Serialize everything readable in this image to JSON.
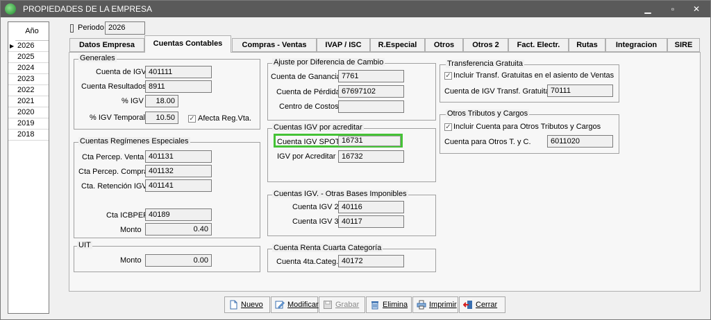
{
  "window": {
    "title": "PROPIEDADES DE LA EMPRESA",
    "min": "▁",
    "max": "▫",
    "close": "✕"
  },
  "years": {
    "header": "Año",
    "rows": [
      "2026",
      "2025",
      "2024",
      "2023",
      "2022",
      "2021",
      "2020",
      "2019",
      "2018"
    ],
    "selected_marker": "▶"
  },
  "periodo": {
    "label": "Periodo",
    "value": "2026"
  },
  "tabs": [
    "Datos Empresa",
    "Cuentas Contables",
    "Compras - Ventas",
    "IVAP / ISC",
    "R.Especial",
    "Otros",
    "Otros 2",
    "Fact. Electr.",
    "Rutas",
    "Integracion",
    "SIRE"
  ],
  "generales": {
    "title": "Generales",
    "cuenta_igv": {
      "label": "Cuenta de IGV",
      "value": "401111"
    },
    "cuenta_resultados": {
      "label": "Cuenta Resultados",
      "value": "8911"
    },
    "pct_igv": {
      "label": "% IGV",
      "value": "18.00"
    },
    "pct_igv_temporal": {
      "label": "% IGV Temporal",
      "value": "10.50"
    },
    "afecta": {
      "label": "Afecta Reg.Vta.",
      "mark": "✓"
    }
  },
  "regimenes": {
    "title": "Cuentas Regímenes Especiales",
    "percep_venta": {
      "label": "Cta Percep. Venta",
      "value": "401131"
    },
    "percep_compra": {
      "label": "Cta Percep. Compra",
      "value": "401132"
    },
    "retencion": {
      "label": "Cta. Retención IGV",
      "value": "401141"
    },
    "icbper": {
      "label": "Cta ICBPER",
      "value": "40189"
    },
    "monto": {
      "label": "Monto",
      "value": "0.40"
    }
  },
  "uit": {
    "title": "UIT",
    "monto": {
      "label": "Monto",
      "value": "0.00"
    }
  },
  "ajuste": {
    "title": "Ajuste por Diferencia de Cambio",
    "ganancia": {
      "label": "Cuenta de Ganancia",
      "value": "7761"
    },
    "perdida": {
      "label": "Cuenta de Pérdida",
      "value": "67697102"
    },
    "centro": {
      "label": "Centro de Costos",
      "value": ""
    }
  },
  "igv_acreditar": {
    "title": "Cuentas IGV por acreditar",
    "spot": {
      "label": "Cuenta IGV SPOT",
      "value": "16731"
    },
    "acreditar": {
      "label": "IGV por Acreditar",
      "value": "16732"
    }
  },
  "otras_bases": {
    "title": "Cuentas IGV. - Otras Bases Imponibles",
    "igv2": {
      "label": "Cuenta IGV 2",
      "value": "40116"
    },
    "igv3": {
      "label": "Cuenta IGV 3",
      "value": "40117"
    }
  },
  "renta_cuarta": {
    "title": "Cuenta Renta Cuarta Categoría",
    "cuenta": {
      "label": "Cuenta 4ta.Categ.:",
      "value": "40172"
    }
  },
  "transferencia": {
    "title": "Transferencia Gratuita",
    "check": {
      "label": "Incluir Transf. Gratuitas en el asiento de Ventas",
      "mark": "✓"
    },
    "cuenta": {
      "label": "Cuenta de IGV Transf. Gratuita",
      "value": "70111"
    }
  },
  "otros_tributos": {
    "title": "Otros Tributos y Cargos",
    "check": {
      "label": "Incluir Cuenta para Otros Tributos y Cargos",
      "mark": "✓"
    },
    "cuenta": {
      "label": "Cuenta para Otros T. y C.",
      "value": "6011020"
    }
  },
  "buttons": {
    "nuevo": "Nuevo",
    "modificar": "Modificar",
    "grabar": "Grabar",
    "elimina": "Elimina",
    "imprimir": "Imprimir",
    "cerrar": "Cerrar"
  },
  "colors": {
    "titlebar": "#5a5a5a",
    "highlight": "#45c236",
    "panel": "#f7f7f7"
  }
}
